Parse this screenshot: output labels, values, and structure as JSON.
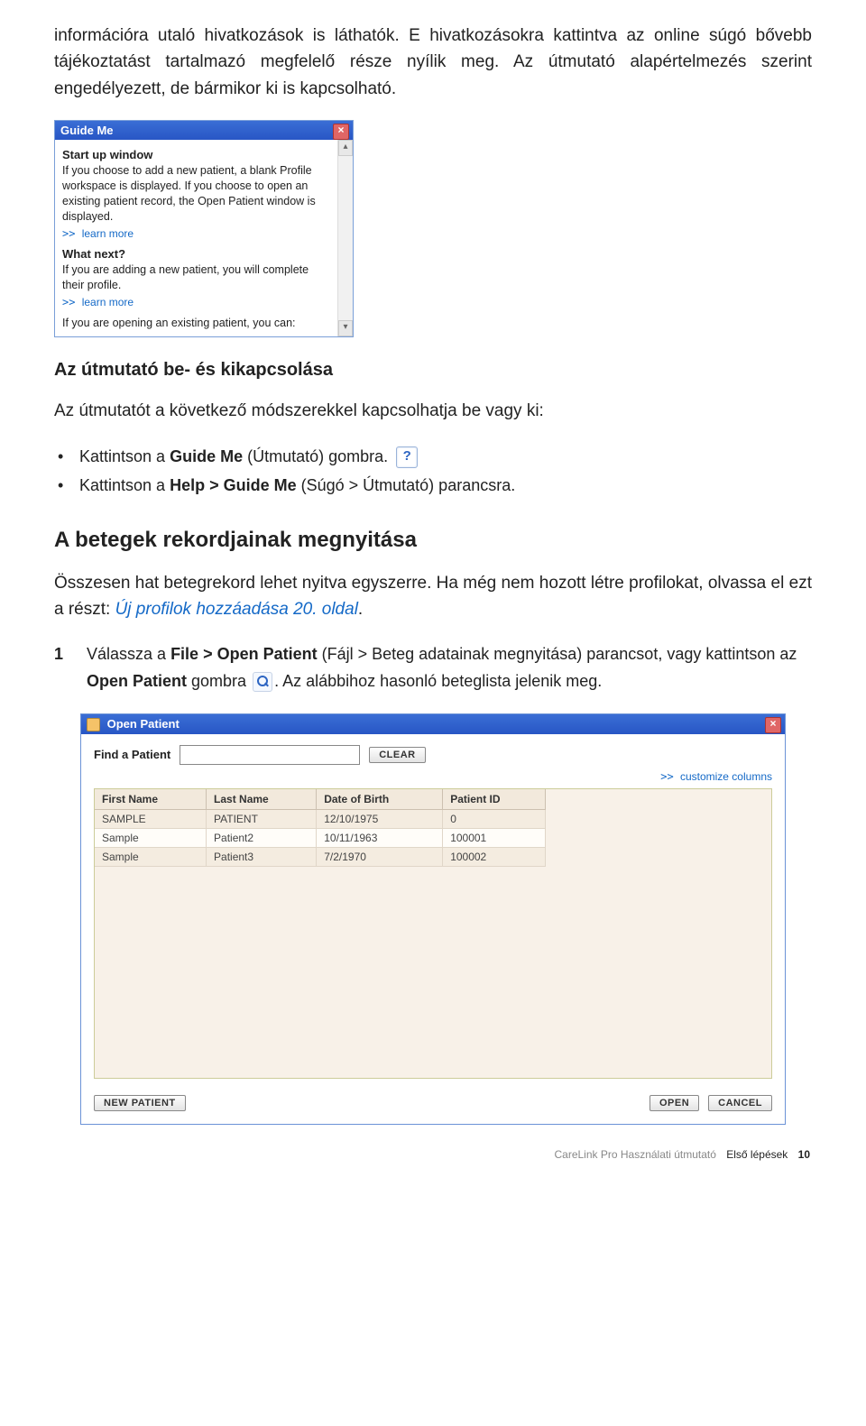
{
  "intro": {
    "p1": "információra utaló hivatkozások is láthatók. E hivatkozásokra kattintva az online súgó bővebb tájékoztatást tartalmazó megfelelő része nyílik meg. Az útmutató alapértelmezés szerint engedélyezett, de bármikor ki is kapcsolható."
  },
  "guideme": {
    "title": "Guide Me",
    "h1": "Start up window",
    "t1": "If you choose to add a new patient, a blank Profile workspace is displayed. If you choose to open an existing patient record, the Open Patient window is displayed.",
    "l1": "learn more",
    "h2": "What next?",
    "t2": "If you are adding a new patient, you will complete their profile.",
    "l2": "learn more",
    "t3": "If you are opening an existing patient, you can:"
  },
  "sec1": {
    "h": "Az útmutató be- és kikapcsolása",
    "p": "Az útmutatót a következő módszerekkel kapcsolhatja be vagy ki:",
    "b1a": "Kattintson a ",
    "b1b": "Guide Me",
    "b1c": " (Útmutató) gombra.",
    "b2a": "Kattintson a ",
    "b2b": "Help > Guide Me",
    "b2c": " (Súgó > Útmutató) parancsra."
  },
  "sec2": {
    "h": "A betegek rekordjainak megnyitása",
    "p1a": "Összesen hat betegrekord lehet nyitva egyszerre. Ha még nem hozott létre profilokat, olvassa el ezt a részt: ",
    "p1link": "Új profilok hozzáadása 20. oldal",
    "p1b": ".",
    "step1_num": "1",
    "step1a": "Válassza a ",
    "step1b": "File > Open Patient",
    "step1c": " (Fájl > Beteg adatainak megnyitása) parancsot, vagy kattintson az ",
    "step1d": "Open Patient",
    "step1e": " gombra ",
    "step1f": ". Az alábbihoz hasonló beteglista jelenik meg."
  },
  "openpatient": {
    "title": "Open Patient",
    "find": "Find a Patient",
    "clear": "CLEAR",
    "customize": "customize columns",
    "cols": [
      "First Name",
      "Last Name",
      "Date of Birth",
      "Patient ID"
    ],
    "rows": [
      [
        "SAMPLE",
        "PATIENT",
        "12/10/1975",
        "0"
      ],
      [
        "Sample",
        "Patient2",
        "10/11/1963",
        "100001"
      ],
      [
        "Sample",
        "Patient3",
        "7/2/1970",
        "100002"
      ]
    ],
    "newp": "NEW PATIENT",
    "open": "OPEN",
    "cancel": "CANCEL"
  },
  "footer": {
    "a": "CareLink Pro Használati útmutató",
    "b": "Első lépések",
    "pg": "10"
  }
}
